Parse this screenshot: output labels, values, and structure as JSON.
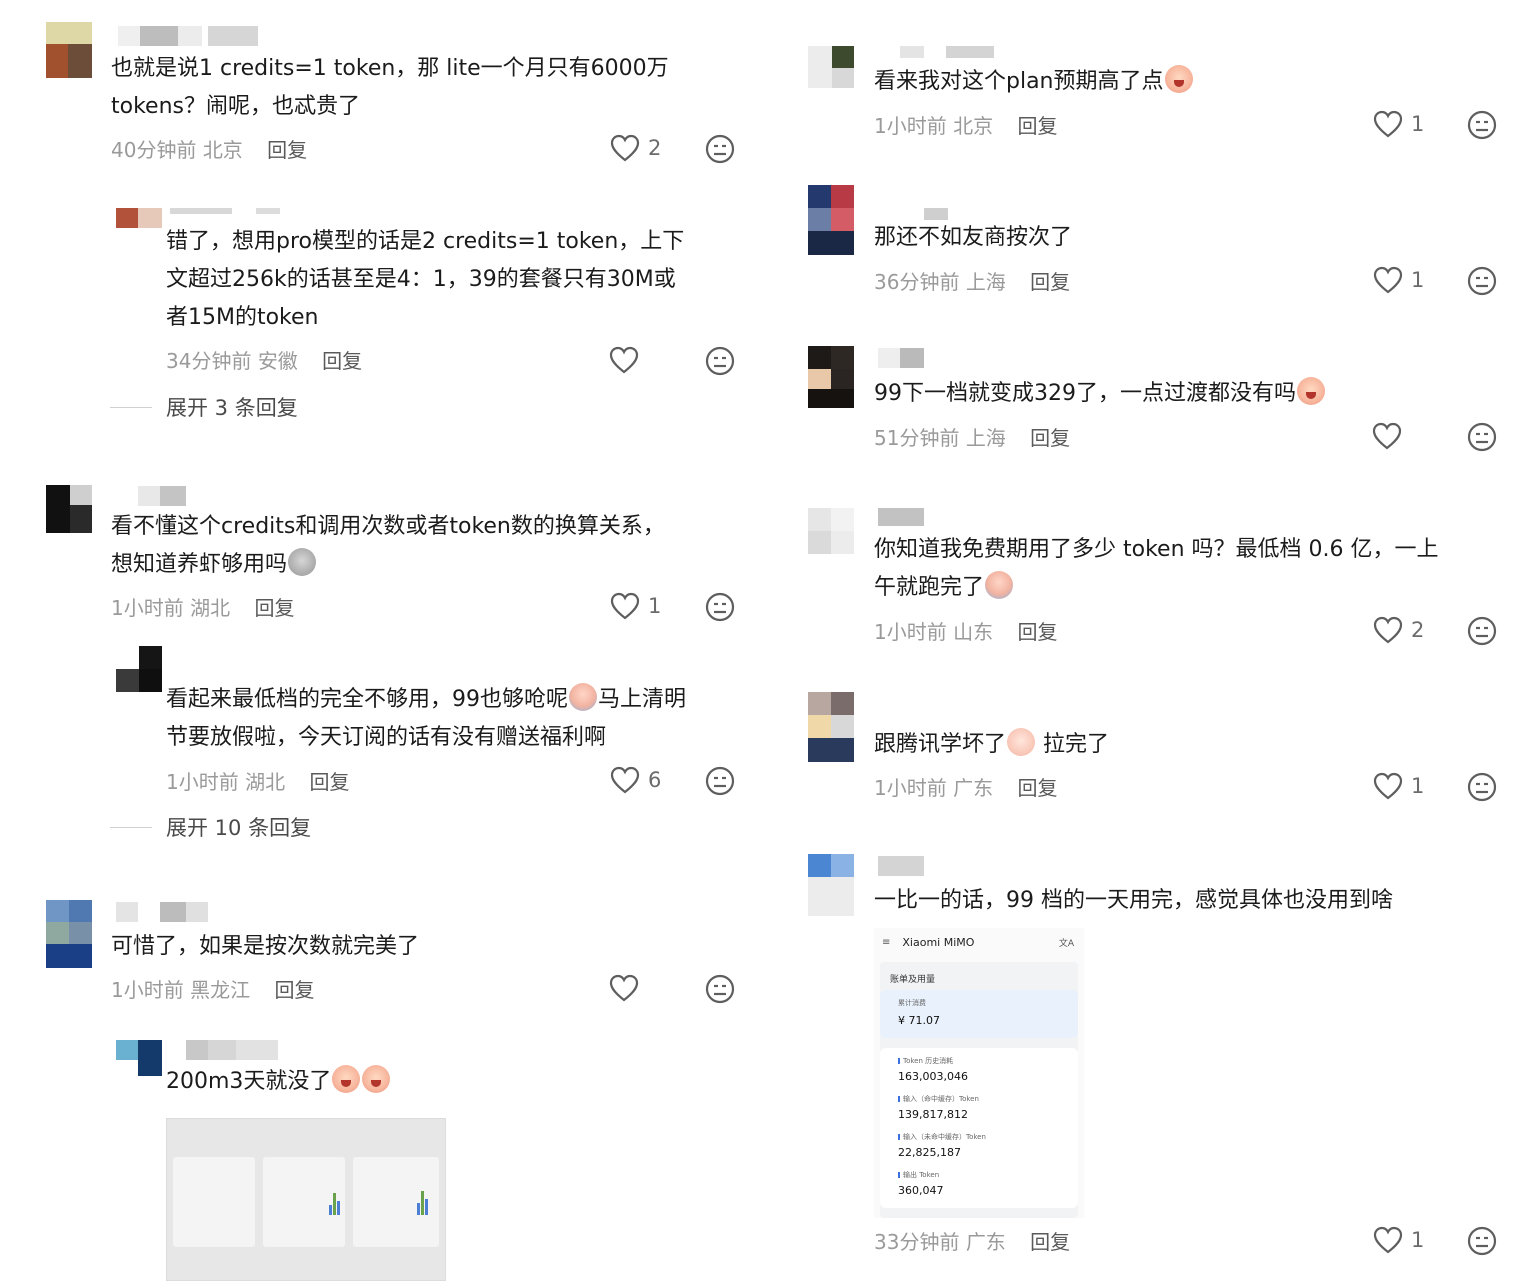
{
  "left_column": {
    "comments": [
      {
        "text_lines": [
          "也就是说1 credits=1 token，那 lite一个月只有6000万",
          "tokens？闹呢，也忒贵了"
        ],
        "time": "40分钟前",
        "location": "北京",
        "reply": "回复",
        "likes": "2"
      },
      {
        "text_lines": [
          "错了，想用pro模型的话是2 credits=1 token，上下",
          "文超过256k的话甚至是4：1，39的套餐只有30M或",
          "者15M的token"
        ],
        "time": "34分钟前",
        "location": "安徽",
        "reply": "回复",
        "likes": "",
        "expand": "展开 3 条回复"
      },
      {
        "text_lines": [
          "看不懂这个credits和调用次数或者token数的换算关系，",
          "想知道养虾够用吗"
        ],
        "time": "1小时前",
        "location": "湖北",
        "reply": "回复",
        "likes": "1"
      },
      {
        "text_lines": [
          "看起来最低档的完全不够用，99也够呛呢",
          "马上清明",
          "节要放假啦，今天订阅的话有没有赠送福利啊"
        ],
        "time": "1小时前",
        "location": "湖北",
        "reply": "回复",
        "likes": "6",
        "expand": "展开 10 条回复"
      },
      {
        "text_lines": [
          "可惜了，如果是按次数就完美了"
        ],
        "time": "1小时前",
        "location": "黑龙江",
        "reply": "回复",
        "likes": ""
      },
      {
        "text_lines": [
          "200m3天就没了"
        ]
      }
    ]
  },
  "right_column": {
    "comments": [
      {
        "text_lines": [
          "看来我对这个plan预期高了点"
        ],
        "time": "1小时前",
        "location": "北京",
        "reply": "回复",
        "likes": "1"
      },
      {
        "text_lines": [
          "那还不如友商按次了"
        ],
        "time": "36分钟前",
        "location": "上海",
        "reply": "回复",
        "likes": "1"
      },
      {
        "text_lines": [
          "99下一档就变成329了，一点过渡都没有吗"
        ],
        "time": "51分钟前",
        "location": "上海",
        "reply": "回复",
        "likes": ""
      },
      {
        "text_lines": [
          "你知道我免费期用了多少 token 吗？最低档 0.6 亿，一上",
          "午就跑完了"
        ],
        "time": "1小时前",
        "location": "山东",
        "reply": "回复",
        "likes": "2"
      },
      {
        "text_lines": [
          "跟腾讯学坏了",
          "拉完了"
        ],
        "time": "1小时前",
        "location": "广东",
        "reply": "回复",
        "likes": "1"
      },
      {
        "text_lines": [
          "一比一的话，99 档的一天用完，感觉具体也没用到啥"
        ],
        "time": "33分钟前",
        "location": "广东",
        "reply": "回复",
        "likes": "1"
      }
    ],
    "mimo_screenshot": {
      "app_name": "Xiaomi MiMO",
      "section_title": "账单及用量",
      "total_label": "累计消费",
      "total_value": "¥ 71.07",
      "rows": [
        {
          "label": "Token 历史消耗",
          "value": "163,003,046"
        },
        {
          "label": "输入（命中缓存）Token",
          "value": "139,817,812"
        },
        {
          "label": "输入（未命中缓存）Token",
          "value": "22,825,187"
        },
        {
          "label": "输出 Token",
          "value": "360,047"
        }
      ]
    }
  },
  "colors": {
    "text": "#1b1b1b",
    "meta": "#9a9a9a",
    "icon": "#6b6b6b",
    "accent": "#3c6fe0"
  }
}
